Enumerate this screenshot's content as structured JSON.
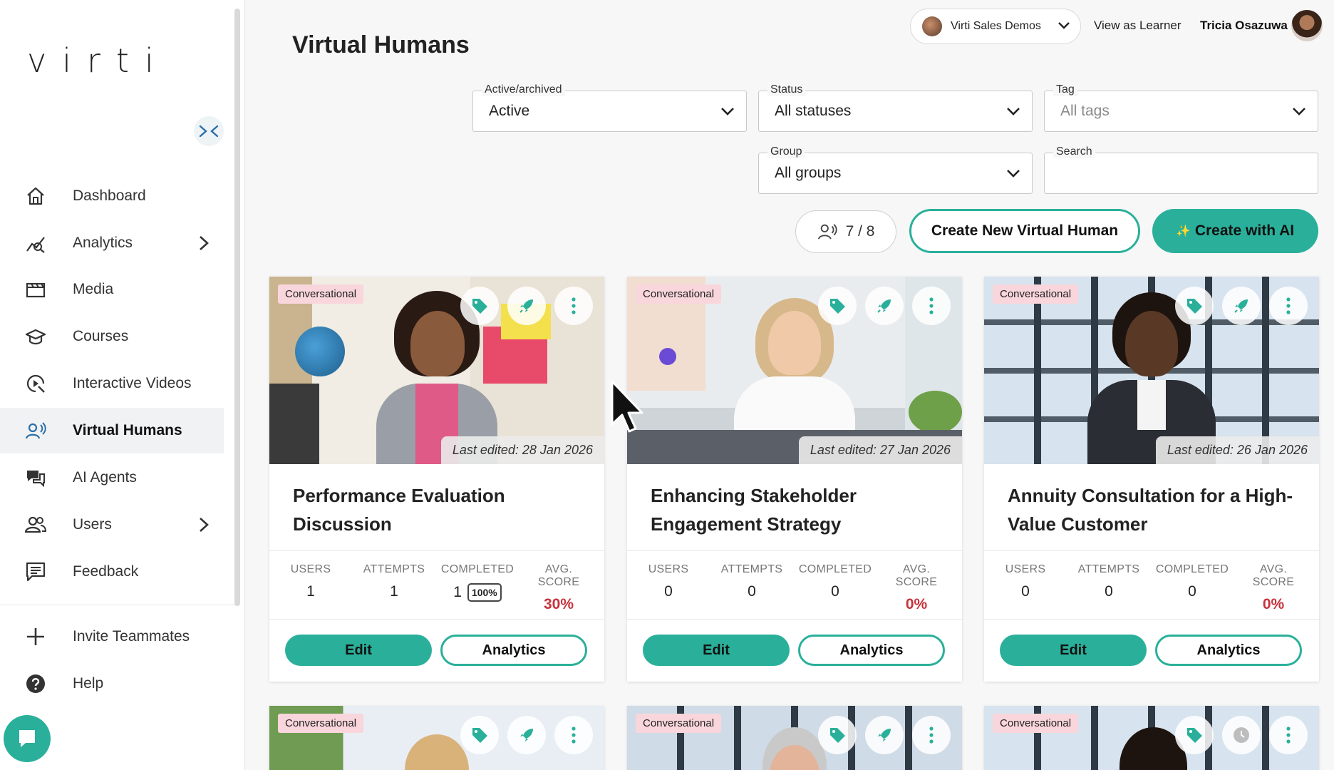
{
  "app": {
    "logo": "virti"
  },
  "sidebar": {
    "items": [
      {
        "label": "Dashboard",
        "icon": "home-icon"
      },
      {
        "label": "Analytics",
        "icon": "analytics-icon"
      },
      {
        "label": "Media",
        "icon": "media-icon"
      },
      {
        "label": "Courses",
        "icon": "courses-icon"
      },
      {
        "label": "Interactive Videos",
        "icon": "interactive-video-icon"
      },
      {
        "label": "Virtual Humans",
        "icon": "virtual-human-icon",
        "active": true
      },
      {
        "label": "AI Agents",
        "icon": "ai-agent-icon"
      },
      {
        "label": "Users",
        "icon": "users-icon"
      },
      {
        "label": "Feedback",
        "icon": "feedback-icon"
      }
    ],
    "bottom": [
      {
        "label": "Invite Teammates",
        "icon": "plus-icon"
      },
      {
        "label": "Help",
        "icon": "help-icon"
      }
    ]
  },
  "header": {
    "title": "Virtual Humans",
    "org": "Virti Sales Demos",
    "view_as_learner": "View as Learner",
    "user_name": "Tricia Osazuwa"
  },
  "filters": {
    "active": {
      "label": "Active/archived",
      "value": "Active"
    },
    "status": {
      "label": "Status",
      "value": "All statuses"
    },
    "tag": {
      "label": "Tag",
      "placeholder": "All tags"
    },
    "group": {
      "label": "Group",
      "value": "All groups"
    },
    "search": {
      "label": "Search",
      "value": ""
    }
  },
  "toolbar": {
    "counter": "7 / 8",
    "create_new": "Create New Virtual Human",
    "create_ai": "Create with AI",
    "create_ai_icon": "✨"
  },
  "stat_labels": {
    "users": "USERS",
    "attempts": "ATTEMPTS",
    "completed": "COMPLETED",
    "avg_score": "AVG. SCORE"
  },
  "card_buttons": {
    "edit": "Edit",
    "analytics": "Analytics"
  },
  "cards": [
    {
      "badge": "Conversational",
      "edited": "Last edited:  28 Jan 2026",
      "title": "Performance Evaluation Discussion",
      "users": "1",
      "attempts": "1",
      "completed": "1",
      "completed_pct": "100%",
      "avg_score": "30%"
    },
    {
      "badge": "Conversational",
      "edited": "Last edited:  27 Jan 2026",
      "title": "Enhancing Stakeholder Engagement Strategy",
      "users": "0",
      "attempts": "0",
      "completed": "0",
      "avg_score": "0%"
    },
    {
      "badge": "Conversational",
      "edited": "Last edited:  26 Jan 2026",
      "title": "Annuity Consultation for a High-Value Customer",
      "users": "0",
      "attempts": "0",
      "completed": "0",
      "avg_score": "0%"
    },
    {
      "badge": "Conversational"
    },
    {
      "badge": "Conversational"
    },
    {
      "badge": "Conversational"
    }
  ],
  "colors": {
    "accent": "#2ab09a",
    "score_red": "#c8323c",
    "badge_bg": "#f9d6dc"
  }
}
